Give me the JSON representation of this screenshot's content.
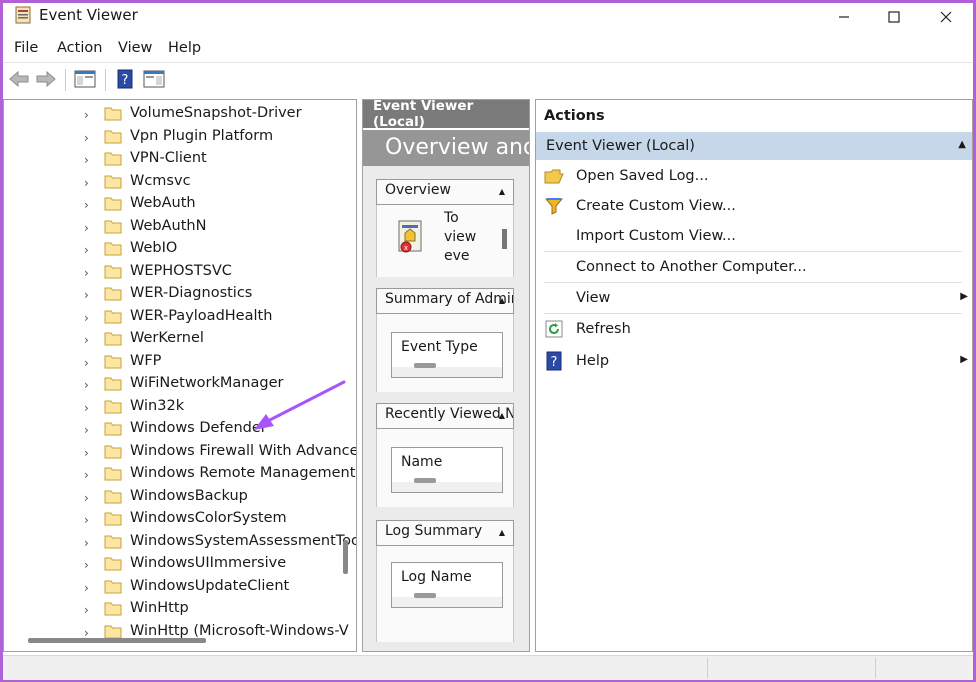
{
  "window": {
    "title": "Event Viewer",
    "minimize": "—",
    "maximize": "☐",
    "close": "✕"
  },
  "menu": [
    "File",
    "Action",
    "View",
    "Help"
  ],
  "tree": {
    "items": [
      "VolumeSnapshot-Driver",
      "Vpn Plugin Platform",
      "VPN-Client",
      "Wcmsvc",
      "WebAuth",
      "WebAuthN",
      "WebIO",
      "WEPHOSTSVC",
      "WER-Diagnostics",
      "WER-PayloadHealth",
      "WerKernel",
      "WFP",
      "WiFiNetworkManager",
      "Win32k",
      "Windows Defender",
      "Windows Firewall With Advance",
      "Windows Remote Management",
      "WindowsBackup",
      "WindowsColorSystem",
      "WindowsSystemAssessmentToo",
      "WindowsUIImmersive",
      "WindowsUpdateClient",
      "WinHttp",
      "WinHttp (Microsoft-Windows-V"
    ]
  },
  "middle": {
    "header": "Event Viewer (Local)",
    "banner": "Overview and",
    "overview_title": "Overview",
    "overview_text": [
      "To",
      "view",
      "eve"
    ],
    "summary_title": "Summary of Administrativ",
    "summary_col": "Event Type",
    "recent_title": "Recently Viewed Nodes",
    "recent_col": "Name",
    "log_title": "Log Summary",
    "log_col": "Log Name"
  },
  "actions": {
    "header": "Actions",
    "section": "Event Viewer (Local)",
    "items": [
      {
        "label": "Open Saved Log...",
        "icon": "folder-open-icon"
      },
      {
        "label": "Create Custom View...",
        "icon": "filter-icon"
      },
      {
        "label": "Import Custom View...",
        "icon": ""
      },
      {
        "label": "Connect to Another Computer...",
        "icon": ""
      },
      {
        "label": "View",
        "icon": ""
      },
      {
        "label": "Refresh",
        "icon": "refresh-icon"
      },
      {
        "label": "Help",
        "icon": "help-icon"
      }
    ]
  },
  "colors": {
    "accent": "#b061d8",
    "section_bg": "#c7d7ea",
    "arrow": "#a855f7"
  }
}
